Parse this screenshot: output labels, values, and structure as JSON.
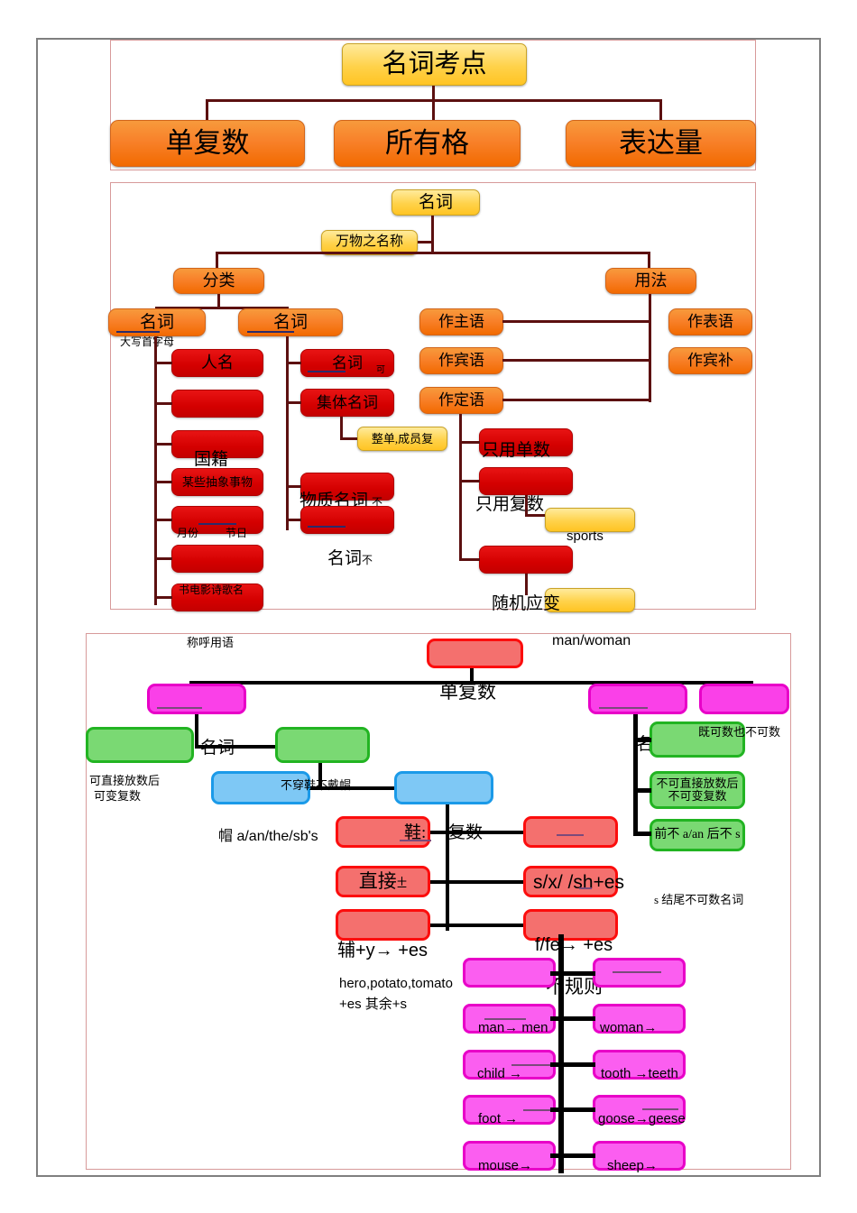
{
  "doc": {
    "title_zh": "名词考点"
  },
  "section1": {
    "root": "名词考点",
    "children": [
      "单复数",
      "所有格",
      "表达量"
    ]
  },
  "section2": {
    "root": "名词",
    "definition": "万物之名称",
    "branch_left": "分类",
    "branch_right": "用法",
    "cat_proper": "名词",
    "cat_proper_note": "大写首字母",
    "cat_common": "名词",
    "proper_items": [
      "人名",
      "",
      "国籍",
      "某些抽象事物",
      "",
      ""
    ],
    "proper_item_labels": {
      "months": "月份",
      "festivals": "节日",
      "media": "书电影诗歌名"
    },
    "common_items": [
      "名词",
      "集体名词",
      "",
      ""
    ],
    "common_item_sub": {
      "countable_mark": "可",
      "collective_note": "整单,成员复"
    },
    "material_noun": "物质名词",
    "material_mark": "不",
    "abstract_noun": "名词",
    "abstract_mark": "不",
    "usage_left": [
      "作主语",
      "作宾语",
      "作定语"
    ],
    "usage_right": [
      "作表语",
      "作宾补"
    ],
    "number_rules": [
      "只用单数",
      "只用复数",
      ""
    ],
    "sports_note": "sports",
    "flex_note": "随机应变"
  },
  "section3": {
    "root_label": "单复数",
    "top_left_note": "称呼用语",
    "top_right_note": "man/woman",
    "countable_label": "名词",
    "countable_note_1": "可直接放数后",
    "countable_note_2": "可变复数",
    "uncountable_label": "名词",
    "uncountable_note_1": "不可直接放数后",
    "uncountable_note_2": "不可变复数",
    "uncountable_note_3": "前不 a/an 后不 s",
    "both_note": "既可数也不可数",
    "singular_note": "不穿鞋不戴帽",
    "article_note": "帽 a/an/the/sb's",
    "shoe_note": "鞋:",
    "plural_label": "复数",
    "plural_rules_left": [
      "鞋:",
      "直接±",
      "辅+y→ +es"
    ],
    "plural_rules_right": [
      "",
      "s/x/    /sh+es",
      "f/fe→ +es"
    ],
    "hero_note_1": "hero,potato,tomato",
    "hero_note_2": "+es 其余+s",
    "s_ending_note": "s 结尾不可数名词",
    "irregular_label": "不规则",
    "irregular_pairs": [
      {
        "left": "",
        "right": ""
      },
      {
        "left": "man→ men",
        "right": "woman→"
      },
      {
        "left": "child  →",
        "right": "tooth  →teeth"
      },
      {
        "left": "foot  →",
        "right": "goose→geese"
      },
      {
        "left": "mouse→",
        "right": "sheep→"
      }
    ]
  },
  "colors": {
    "gold": "#ffd24a",
    "orange": "#f8812a",
    "red": "#d40000",
    "salmon": "#f4706e",
    "magenta": "#fa40e8",
    "green": "#7ad973",
    "blue": "#7ec8f5",
    "frame": "#d79a9a",
    "outer": "#7f7f7f"
  }
}
